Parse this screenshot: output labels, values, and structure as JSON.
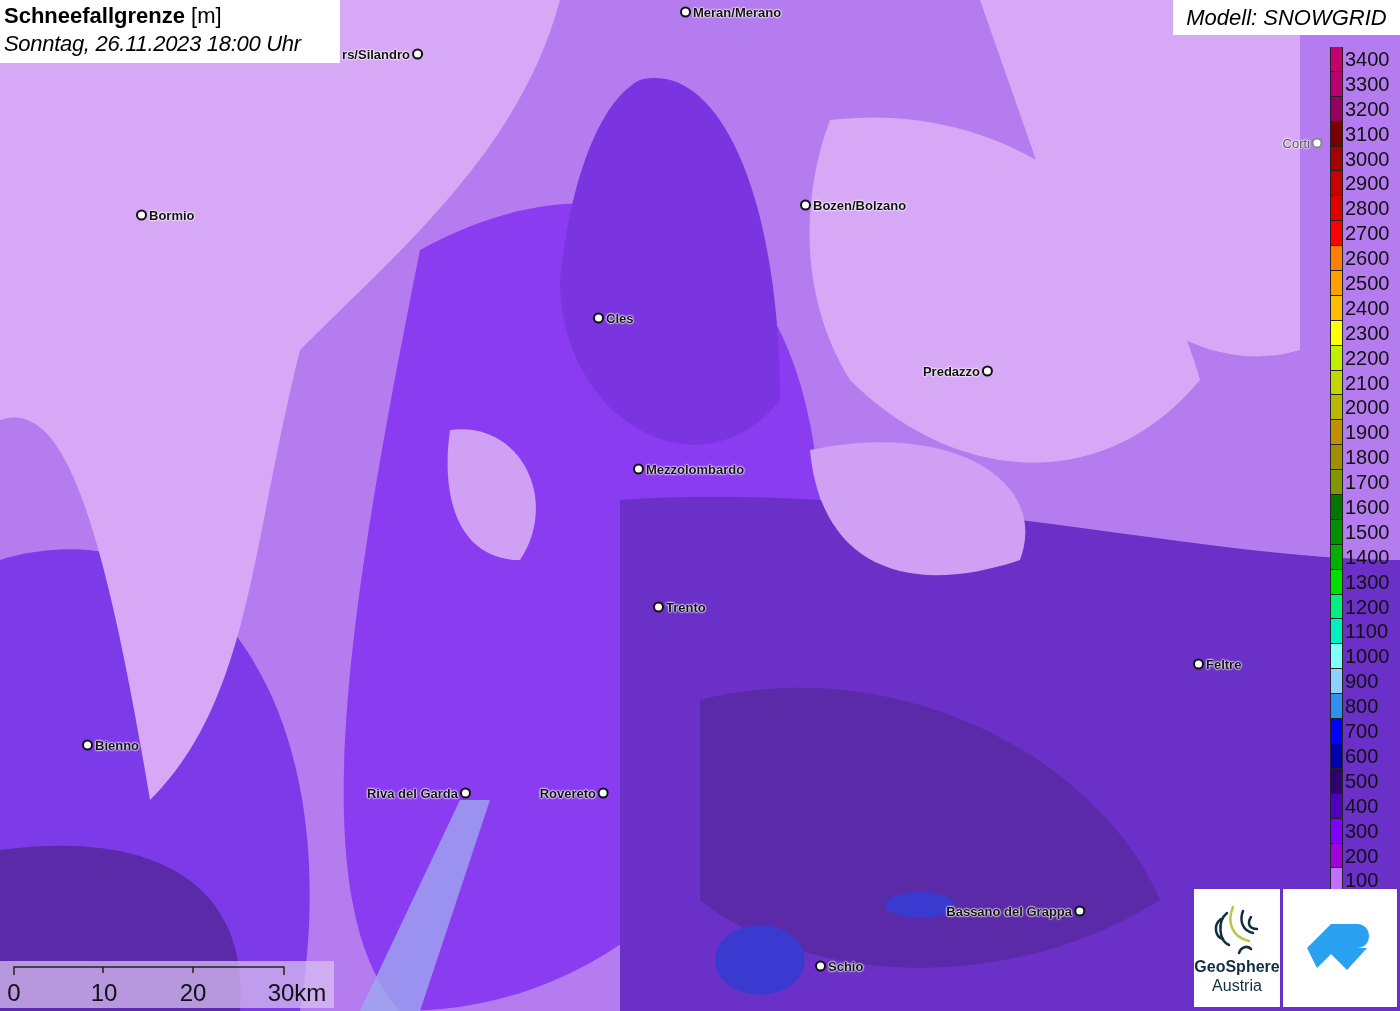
{
  "title": {
    "heading": "Schneefallgrenze",
    "unit": "[m]",
    "datetime": "Sonntag, 26.11.2023 18:00 Uhr"
  },
  "model": "Modell: SNOWGRID",
  "cities": [
    {
      "name": "rs/Silandro",
      "faded": false
    },
    {
      "name": "Meran/Merano",
      "faded": false
    },
    {
      "name": "Bormio",
      "faded": false
    },
    {
      "name": "Bozen/Bolzano",
      "faded": false
    },
    {
      "name": "Cles",
      "faded": false
    },
    {
      "name": "Predazzo",
      "faded": false
    },
    {
      "name": "Mezzolombardo",
      "faded": false
    },
    {
      "name": "Trento",
      "faded": false
    },
    {
      "name": "Feltre",
      "faded": false
    },
    {
      "name": "Bienno",
      "faded": false
    },
    {
      "name": "Riva del Garda",
      "faded": false
    },
    {
      "name": "Rovereto",
      "faded": false
    },
    {
      "name": "Bassano del Grappa",
      "faded": false
    },
    {
      "name": "Schio",
      "faded": false
    },
    {
      "name": "Corti",
      "faded": true
    }
  ],
  "legend": [
    {
      "label": "3400",
      "color": "#c8006e"
    },
    {
      "label": "3300",
      "color": "#b80070"
    },
    {
      "label": "3200",
      "color": "#960064"
    },
    {
      "label": "3100",
      "color": "#7a0000"
    },
    {
      "label": "3000",
      "color": "#a80000"
    },
    {
      "label": "2900",
      "color": "#c80000"
    },
    {
      "label": "2800",
      "color": "#e00000"
    },
    {
      "label": "2700",
      "color": "#ff0000"
    },
    {
      "label": "2600",
      "color": "#ff8000"
    },
    {
      "label": "2500",
      "color": "#ffa000"
    },
    {
      "label": "2400",
      "color": "#ffbe00"
    },
    {
      "label": "2300",
      "color": "#ffff00"
    },
    {
      "label": "2200",
      "color": "#c0f000"
    },
    {
      "label": "2100",
      "color": "#c0d800"
    },
    {
      "label": "2000",
      "color": "#b8b800"
    },
    {
      "label": "1900",
      "color": "#c09000"
    },
    {
      "label": "1800",
      "color": "#a09000"
    },
    {
      "label": "1700",
      "color": "#809800"
    },
    {
      "label": "1600",
      "color": "#007800"
    },
    {
      "label": "1500",
      "color": "#009000"
    },
    {
      "label": "1400",
      "color": "#00b000"
    },
    {
      "label": "1300",
      "color": "#00e000"
    },
    {
      "label": "1200",
      "color": "#00f080"
    },
    {
      "label": "1100",
      "color": "#00f0c0"
    },
    {
      "label": "1000",
      "color": "#80ffff"
    },
    {
      "label": "900",
      "color": "#90d0ff"
    },
    {
      "label": "800",
      "color": "#3090f0"
    },
    {
      "label": "700",
      "color": "#0000ff"
    },
    {
      "label": "600",
      "color": "#0000b0"
    },
    {
      "label": "500",
      "color": "#300070"
    },
    {
      "label": "400",
      "color": "#5000c0"
    },
    {
      "label": "300",
      "color": "#8000ff"
    },
    {
      "label": "200",
      "color": "#a000e0"
    },
    {
      "label": "100",
      "color": "#c070ff"
    }
  ],
  "scale": [
    "0",
    "10",
    "20",
    "30km"
  ],
  "logos": [
    {
      "kind": "geosphere",
      "line_1": "GeoSphere",
      "line_2": "Austria"
    },
    {
      "kind": "mountain"
    }
  ]
}
